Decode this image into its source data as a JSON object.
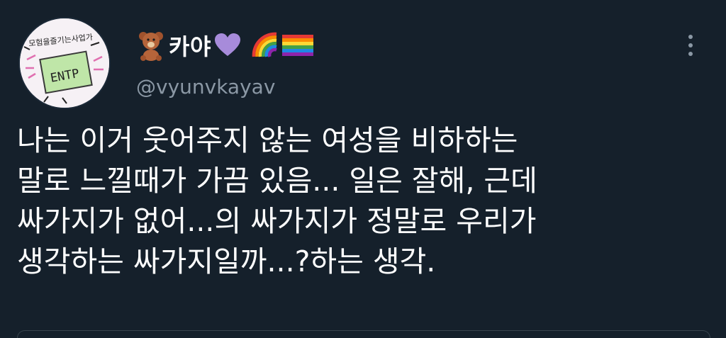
{
  "tweet": {
    "avatar": {
      "badge_text": "ENTP",
      "caption_text": "모험을즐기는사업가"
    },
    "author": {
      "display_name": "카야",
      "handle": "@vyunvkayav",
      "name_emojis": [
        "bear-icon",
        "purple-heart-icon",
        "rainbow-icon",
        "pride-flag-icon"
      ]
    },
    "text_lines": [
      "나는 이거 웃어주지 않는 여성을 비하하는",
      "말로 느낄때가 가끔 있음... 일은 잘해, 근데",
      "싸가지가 없어...의 싸가지가 정말로 우리가",
      "생각하는 싸가지일까...?하는 생각."
    ],
    "menu_icon": "more-vertical-icon"
  },
  "colors": {
    "background": "#15202b",
    "text": "#ffffff",
    "handle": "#8b98a5",
    "heart": "#a78bda"
  }
}
